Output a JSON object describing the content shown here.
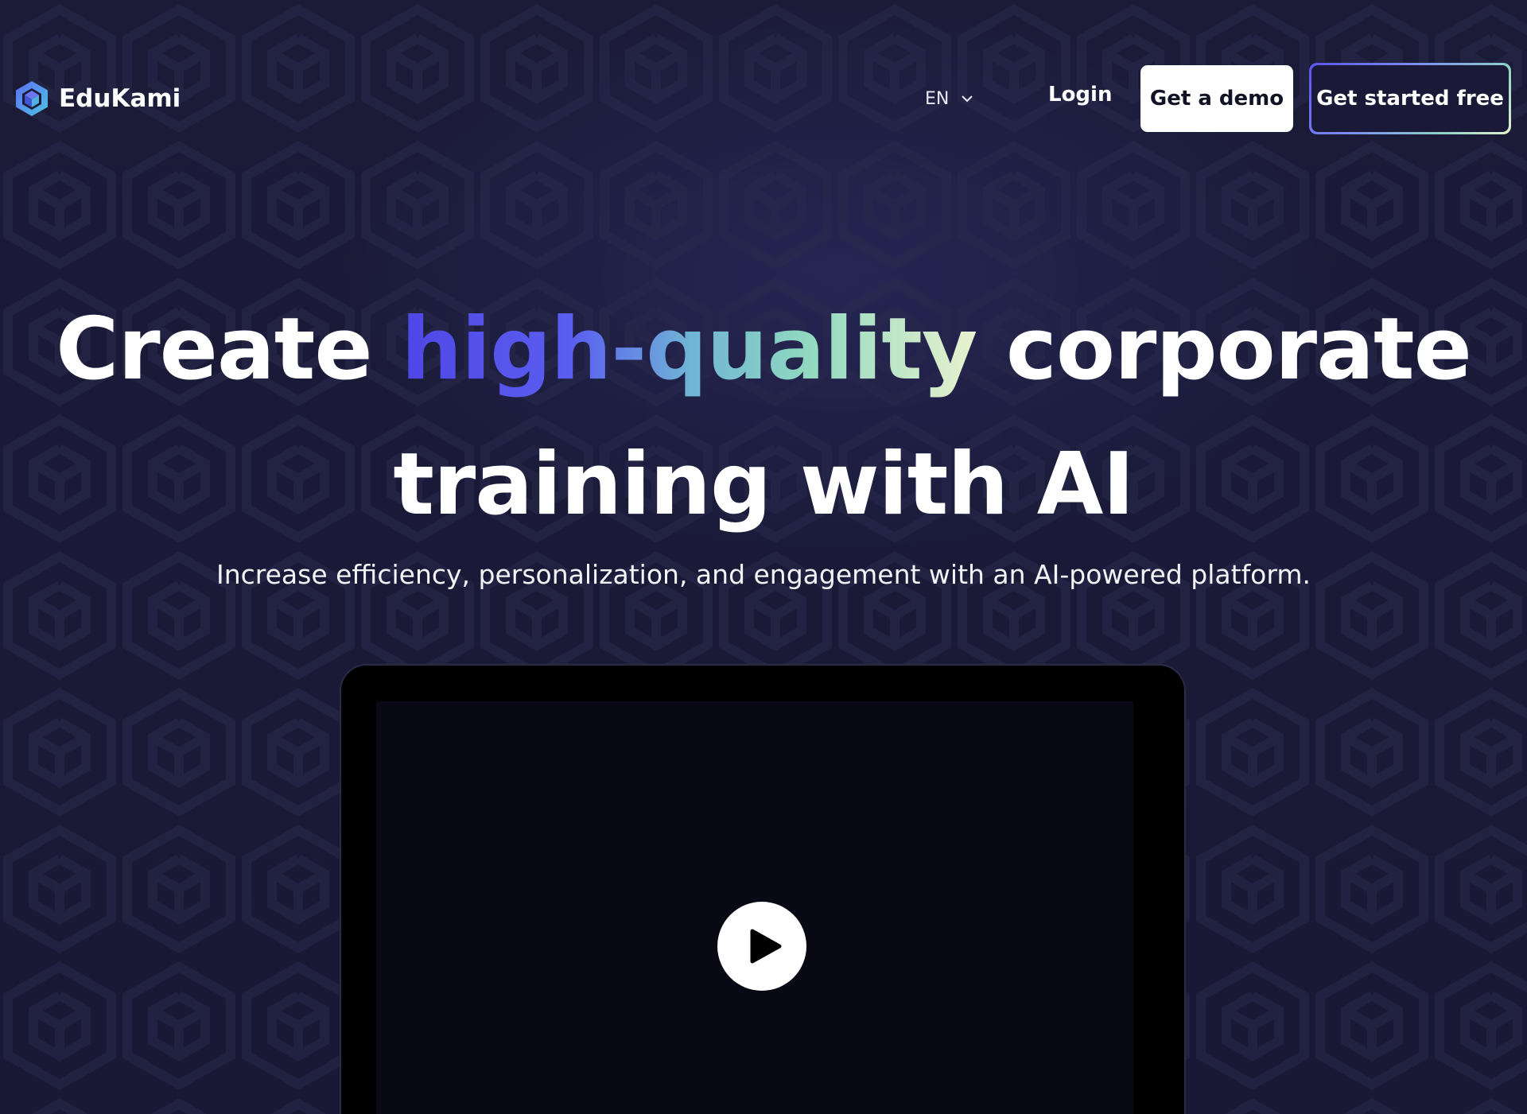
{
  "brand": {
    "name": "EduKami",
    "logo_icon": "cube-icon"
  },
  "nav": {
    "language": "EN",
    "language_icon": "chevron-down-icon",
    "login": "Login",
    "demo_button": "Get a demo",
    "start_button": "Get started free"
  },
  "hero": {
    "title_before": "Create ",
    "title_accent": "high-quality",
    "title_after_line1": " corporate",
    "title_line2": "training with AI",
    "subtitle": "Increase efficiency, personalization, and engagement with an AI-powered platform."
  },
  "video": {
    "play_icon": "play-icon"
  },
  "colors": {
    "background": "#1a1a38",
    "accent_start": "#4f46e5",
    "accent_mid": "#8fd8c0",
    "accent_end": "#e9f2cf",
    "button_light": "#ffffff"
  }
}
